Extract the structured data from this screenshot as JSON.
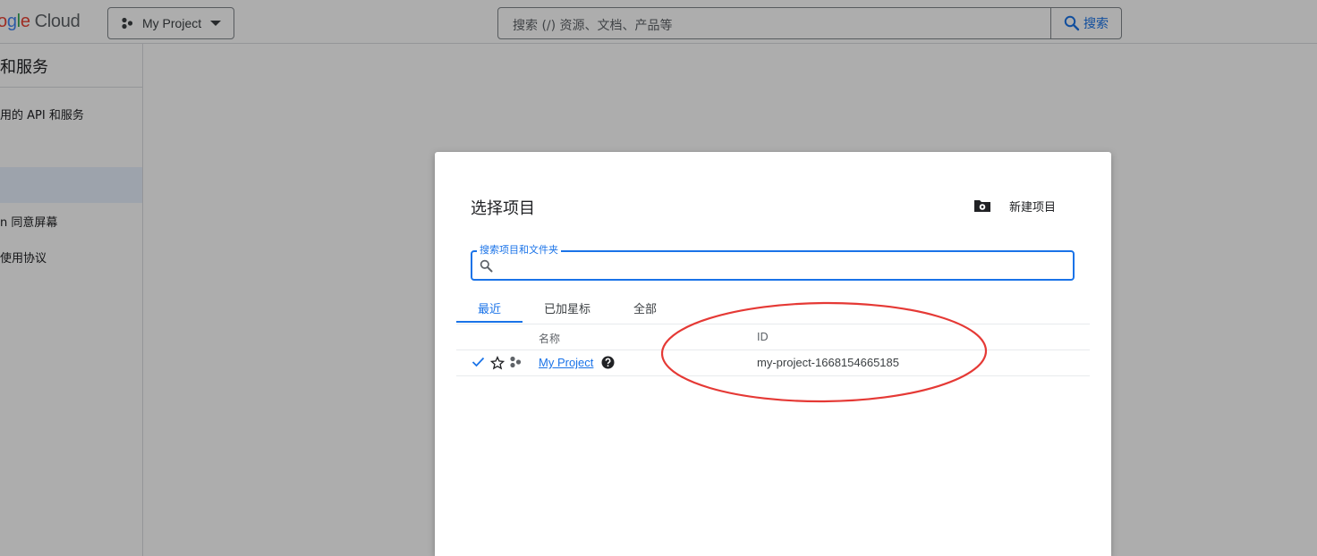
{
  "topbar": {
    "logo_letters": [
      "o",
      "g",
      "l",
      "e"
    ],
    "logo_suffix": "Cloud",
    "project_picker_label": "My Project",
    "search_placeholder": "搜索 (/) 资源、文档、产品等",
    "search_button_label": "搜索"
  },
  "sidenav": {
    "heading": "和服务",
    "items": [
      {
        "label": "用的 API 和服务"
      },
      {
        "label": ""
      },
      {
        "label": "n 同意屏幕"
      },
      {
        "label": "使用协议"
      }
    ]
  },
  "dialog": {
    "title": "选择项目",
    "new_project_label": "新建项目",
    "search_field_label": "搜索项目和文件夹",
    "tabs": [
      {
        "label": "最近",
        "active": true
      },
      {
        "label": "已加星标",
        "active": false
      },
      {
        "label": "全部",
        "active": false
      }
    ],
    "columns": {
      "name": "名称",
      "id": "ID"
    },
    "rows": [
      {
        "name": "My Project",
        "id": "my-project-1668154665185",
        "selected": true,
        "starred": false
      }
    ]
  },
  "colors": {
    "accent": "#1a73e8",
    "annotation": "#e53935",
    "scrim": "rgba(0,0,0,0.32)"
  },
  "icons": [
    "hub-icon",
    "chevron-down-icon",
    "search-icon",
    "folder-settings-icon",
    "check-icon",
    "star-outline-icon",
    "help-circle-icon"
  ]
}
